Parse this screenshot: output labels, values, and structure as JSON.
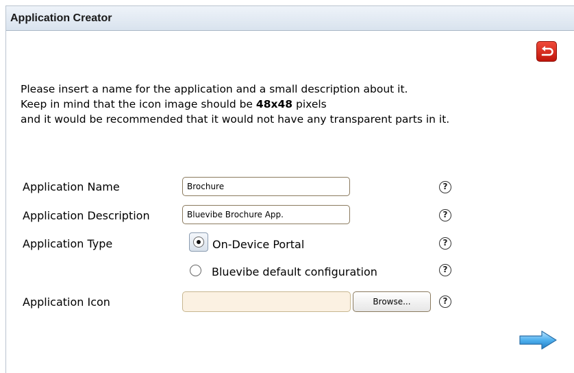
{
  "window": {
    "title": "Application Creator"
  },
  "intro": {
    "line1": "Please insert a name for the application and a small description about it.",
    "line2_before": "Keep in mind that the icon image should be ",
    "line2_bold": "48x48",
    "line2_after": " pixels",
    "line3": "and it would be recommended that it would not have any transparent parts in it."
  },
  "form": {
    "name_label": "Application Name",
    "name_value": "Brochure",
    "description_label": "Application Description",
    "description_value": "Bluevibe Brochure App.",
    "type_label": "Application Type",
    "type_options": [
      "On-Device Portal",
      "Bluevibe default configuration"
    ],
    "type_selected": "On-Device Portal",
    "icon_label": "Application Icon",
    "icon_value": "",
    "browse_label": "Browse...",
    "help_glyph": "?"
  },
  "icons": {
    "back": "back-arrow-icon",
    "next": "next-arrow-icon",
    "help": "help-icon"
  },
  "colors": {
    "back_button": "#d9261a",
    "next_arrow": "#3a9be0",
    "field_border": "#8a7a5e",
    "file_field_bg": "#fbf1e2"
  }
}
